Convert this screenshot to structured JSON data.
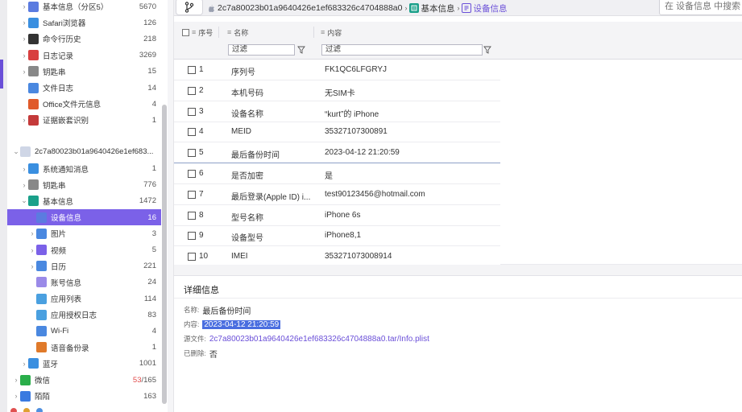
{
  "colors": {
    "accent": "#7b61e8",
    "link": "#6a4fd8",
    "selection": "#4a6ee0"
  },
  "sidebar": {
    "items": [
      {
        "label": "基本信息（分区5）",
        "count": "5670",
        "icon": "info-icon",
        "color": "#5b7be0",
        "chev": "›",
        "indent": 1
      },
      {
        "label": "Safari浏览器",
        "count": "126",
        "icon": "safari-icon",
        "color": "#3a8fe0",
        "chev": "›",
        "indent": 1
      },
      {
        "label": "命令行历史",
        "count": "218",
        "icon": "terminal-icon",
        "color": "#333333",
        "chev": "›",
        "indent": 1
      },
      {
        "label": "日志记录",
        "count": "3269",
        "icon": "log-icon",
        "color": "#d84040",
        "chev": "›",
        "indent": 1
      },
      {
        "label": "钥匙串",
        "count": "15",
        "icon": "keychain-icon",
        "color": "#888888",
        "chev": "›",
        "indent": 1
      },
      {
        "label": "文件日志",
        "count": "14",
        "icon": "file-log-icon",
        "color": "#4a88e0",
        "chev": "",
        "indent": 1
      },
      {
        "label": "Office文件元信息",
        "count": "4",
        "icon": "office-icon",
        "color": "#e05a2a",
        "chev": "",
        "indent": 1
      },
      {
        "label": "证据嵌套识别",
        "count": "1",
        "icon": "evidence-icon",
        "color": "#c43a3a",
        "chev": "›",
        "indent": 1
      }
    ],
    "device": {
      "label": "2c7a80023b01a9640426e1ef683...",
      "chev": "⌄",
      "icon": "device-icon"
    },
    "device_items": [
      {
        "label": "系统通知消息",
        "count": "1",
        "icon": "notification-icon",
        "color": "#3a8fe0",
        "chev": "›",
        "indent": 1
      },
      {
        "label": "钥匙串",
        "count": "776",
        "icon": "keychain-icon",
        "color": "#888888",
        "chev": "›",
        "indent": 1
      },
      {
        "label": "基本信息",
        "count": "1472",
        "icon": "basic-info-icon",
        "color": "#1aa08a",
        "chev": "⌄",
        "indent": 1
      },
      {
        "label": "设备信息",
        "count": "16",
        "icon": "device-info-icon",
        "color": "#5b7be0",
        "chev": "",
        "indent": 2,
        "selected": true
      },
      {
        "label": "图片",
        "count": "3",
        "icon": "image-icon",
        "color": "#4a88e0",
        "chev": "›",
        "indent": 2
      },
      {
        "label": "视频",
        "count": "5",
        "icon": "video-icon",
        "color": "#7b61e8",
        "chev": "›",
        "indent": 2
      },
      {
        "label": "日历",
        "count": "221",
        "icon": "calendar-icon",
        "color": "#4a88e0",
        "chev": "›",
        "indent": 2
      },
      {
        "label": "账号信息",
        "count": "24",
        "icon": "account-icon",
        "color": "#9a8ae8",
        "chev": "",
        "indent": 2
      },
      {
        "label": "应用列表",
        "count": "114",
        "icon": "app-list-icon",
        "color": "#4aa0e0",
        "chev": "",
        "indent": 2
      },
      {
        "label": "应用授权日志",
        "count": "83",
        "icon": "app-auth-icon",
        "color": "#4aa0e0",
        "chev": "",
        "indent": 2
      },
      {
        "label": "Wi-Fi",
        "count": "4",
        "icon": "wifi-icon",
        "color": "#4a88e0",
        "chev": "",
        "indent": 2
      },
      {
        "label": "语音备份录",
        "count": "1",
        "icon": "voice-icon",
        "color": "#e07a2a",
        "chev": "",
        "indent": 2
      },
      {
        "label": "蓝牙",
        "count": "1001",
        "icon": "bluetooth-icon",
        "color": "#3a8fe0",
        "chev": "›",
        "indent": 1
      },
      {
        "label": "微信",
        "count_red": "53",
        "count_rest": "/165",
        "icon": "wechat-icon",
        "color": "#2aae4a",
        "chev": "›",
        "indent": 0
      },
      {
        "label": "陌陌",
        "count": "163",
        "icon": "momo-icon",
        "color": "#3a7ae0",
        "chev": "›",
        "indent": 0
      }
    ]
  },
  "breadcrumb": {
    "device": "2c7a80023b01a9640426e1ef683326c4704888a0",
    "group": "基本信息",
    "current": "设备信息",
    "sep": "›"
  },
  "search": {
    "placeholder": "在 设备信息 中搜索"
  },
  "grid": {
    "columns": {
      "index": "序号",
      "name": "名称",
      "content": "内容"
    },
    "filter_placeholder": "过滤",
    "rows": [
      {
        "num": "1",
        "name": "序列号",
        "value": "FK1QC6LFGRYJ"
      },
      {
        "num": "2",
        "name": "本机号码",
        "value": "无SIM卡"
      },
      {
        "num": "3",
        "name": "设备名称",
        "value": "“kurt”的 iPhone"
      },
      {
        "num": "4",
        "name": "MEID",
        "value": "35327107300891"
      },
      {
        "num": "5",
        "name": "最后备份时间",
        "value": "2023-04-12 21:20:59",
        "highlight": true
      },
      {
        "num": "6",
        "name": "是否加密",
        "value": "是"
      },
      {
        "num": "7",
        "name": "最后登录(Apple ID) i...",
        "value": "test90123456@hotmail.com"
      },
      {
        "num": "8",
        "name": "型号名称",
        "value": "iPhone 6s"
      },
      {
        "num": "9",
        "name": "设备型号",
        "value": "iPhone8,1"
      },
      {
        "num": "10",
        "name": "IMEI",
        "value": "353271073008914"
      }
    ]
  },
  "details": {
    "title": "详细信息",
    "name_label": "名称:",
    "name_value": "最后备份时间",
    "content_label": "内容:",
    "content_value": "2023-04-12 21:20:59",
    "source_label": "源文件:",
    "source_value": "2c7a80023b01a9640426e1ef683326c4704888a0.tar/Info.plist",
    "deleted_label": "已删除:",
    "deleted_value": "否"
  }
}
